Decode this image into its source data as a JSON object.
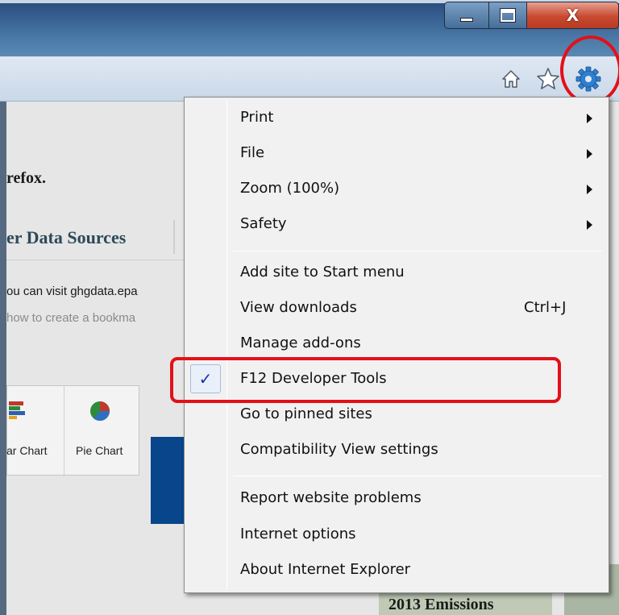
{
  "window": {
    "minimize_icon": "minimize-icon",
    "maximize_icon": "restore-icon",
    "close_label": "X"
  },
  "toolbar": {
    "icons": [
      "home-icon",
      "favorites-star-icon",
      "tools-gear-icon"
    ],
    "gear_color": "#2f7fd0"
  },
  "page": {
    "firefox_text": "refox.",
    "data_sources": "er Data Sources",
    "visit_text": "ou can visit ghgdata.epa",
    "howto_text": "how to create a bookma",
    "bar_chart_label": "ar Chart",
    "pie_chart_label": "Pie Chart",
    "emissions_heading": "2013 Emissions"
  },
  "menu": {
    "items": [
      {
        "label": "Print",
        "submenu": true
      },
      {
        "label": "File",
        "submenu": true
      },
      {
        "label": "Zoom (100%)",
        "submenu": true
      },
      {
        "label": "Safety",
        "submenu": true
      },
      {
        "label": "Add site to Start menu"
      },
      {
        "label": "View downloads",
        "shortcut": "Ctrl+J"
      },
      {
        "label": "Manage add-ons"
      },
      {
        "label": "F12 Developer Tools",
        "checked": true
      },
      {
        "label": "Go to pinned sites"
      },
      {
        "label": "Compatibility View settings"
      },
      {
        "label": "Report website problems"
      },
      {
        "label": "Internet options"
      },
      {
        "label": "About Internet Explorer"
      }
    ],
    "check_glyph": "✓"
  },
  "colors": {
    "highlight_annotation": "#e2101a",
    "check_color": "#1d2fa6"
  }
}
